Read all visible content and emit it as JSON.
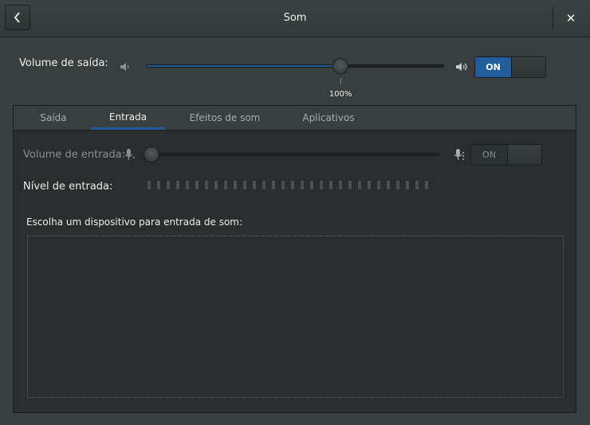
{
  "window": {
    "title": "Som",
    "close_glyph": "✕"
  },
  "output": {
    "label": "Volume de saída:",
    "value_percent": 100,
    "value_text": "100%",
    "switch_label": "ON",
    "switch_on": true
  },
  "tabs": [
    {
      "label": "Saída",
      "active": false
    },
    {
      "label": "Entrada",
      "active": true
    },
    {
      "label": "Efeitos de som",
      "active": false
    },
    {
      "label": "Aplicativos",
      "active": false
    }
  ],
  "input": {
    "volume_label": "Volume de entrada:",
    "volume_fraction": 0,
    "switch_label": "ON",
    "switch_on": false,
    "level_label": "Nível de entrada:",
    "level_fraction": 0,
    "device_prompt": "Escolha um dispositivo para entrada de som:"
  },
  "icons": {
    "back": "chevron-left-icon",
    "close": "close-icon",
    "speaker_low": "speaker-low-icon",
    "speaker_high": "speaker-high-icon",
    "mic_low": "microphone-low-icon",
    "mic_high": "microphone-high-icon"
  },
  "colors": {
    "accent": "#215d9c",
    "background": "#393f3f",
    "pane": "#2b2e2e"
  }
}
